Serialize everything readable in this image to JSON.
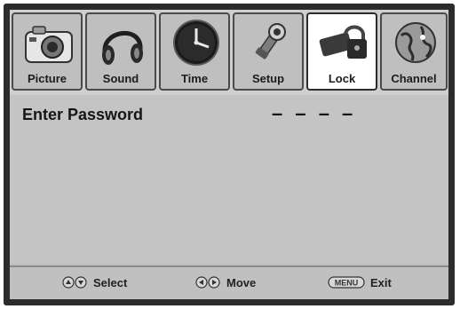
{
  "menu": {
    "tabs": [
      {
        "label": "Picture",
        "icon": "camera-icon",
        "active": false
      },
      {
        "label": "Sound",
        "icon": "headphones-icon",
        "active": false
      },
      {
        "label": "Time",
        "icon": "clock-icon",
        "active": false
      },
      {
        "label": "Setup",
        "icon": "wrench-icon",
        "active": false
      },
      {
        "label": "Lock",
        "icon": "lock-icon",
        "active": true
      },
      {
        "label": "Channel",
        "icon": "globe-icon",
        "active": false
      }
    ]
  },
  "content": {
    "password_label": "Enter Password",
    "password_value": "– – – –"
  },
  "footer": {
    "select": {
      "icon": "up-down-arrows-icon",
      "label": "Select"
    },
    "move": {
      "icon": "left-right-arrows-icon",
      "label": "Move"
    },
    "exit": {
      "icon": "menu-key",
      "key_label": "MENU",
      "label": "Exit"
    }
  }
}
